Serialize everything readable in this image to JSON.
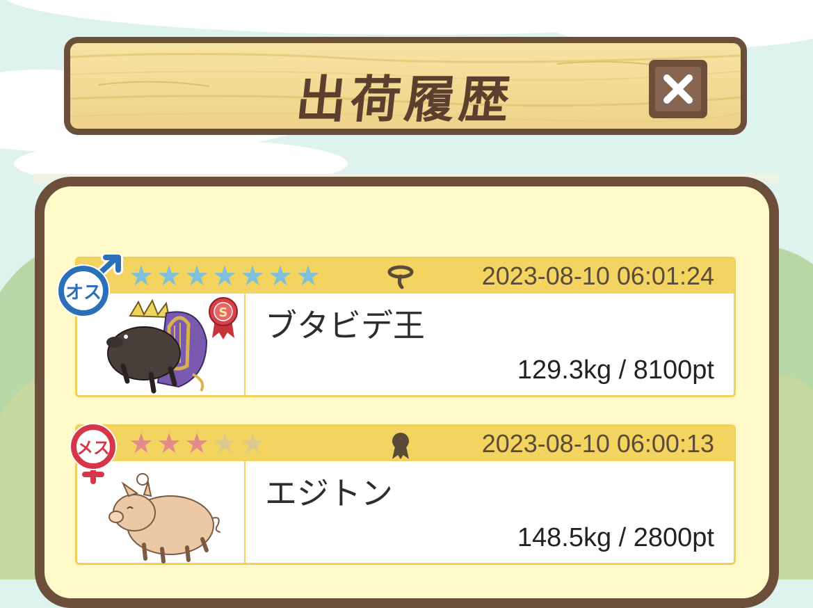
{
  "title": "出荷履歴",
  "colors": {
    "frame": "#6b4f3b",
    "card_header": "#f4d461",
    "panel_bg": "#fffac8",
    "male": "#2a6fb8",
    "female": "#d6364a",
    "star_blue": "#7cc0dd",
    "star_pink": "#e38a8a",
    "star_empty": "#d9c98c"
  },
  "records": [
    {
      "gender_label": "オス",
      "gender_icon": "male-symbol-icon",
      "stars": 7,
      "max_stars": 7,
      "star_color": "#7cc0dd",
      "rank_icon": "lasso-icon",
      "date": "2023-08-10 06:01:24",
      "name": "ブタビデ王",
      "weight": "129.3kg",
      "points": "8100pt",
      "stats": "129.3kg / 8100pt",
      "badge": "S",
      "portrait_icon": "boar-king-icon"
    },
    {
      "gender_label": "メス",
      "gender_icon": "female-symbol-icon",
      "stars": 3,
      "max_stars": 5,
      "star_color": "#e38a8a",
      "rank_icon": "ribbon-icon",
      "date": "2023-08-10 06:00:13",
      "name": "エジトン",
      "weight": "148.5kg",
      "points": "2800pt",
      "stats": "148.5kg / 2800pt",
      "portrait_icon": "pig-icon"
    }
  ]
}
